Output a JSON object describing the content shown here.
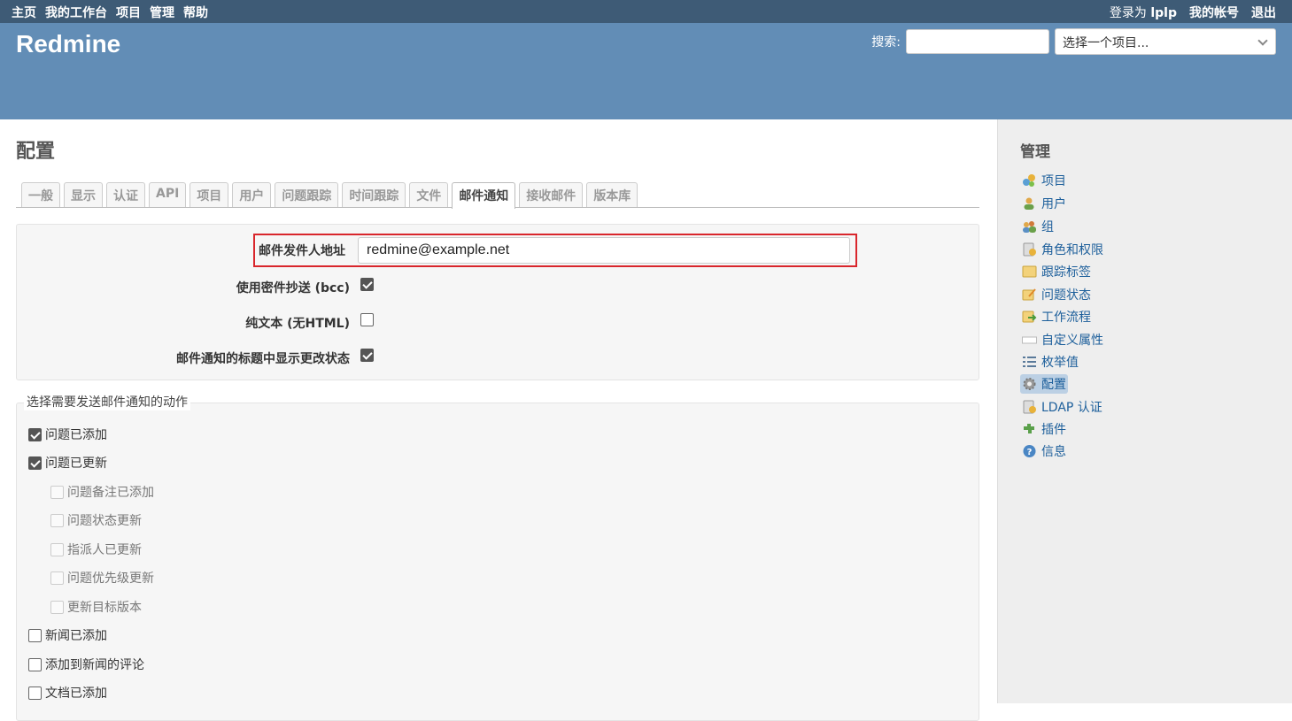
{
  "top_menu": {
    "left_items": [
      "主页",
      "我的工作台",
      "项目",
      "管理",
      "帮助"
    ],
    "logged_as_prefix": "登录为",
    "logged_as_user": "lplp",
    "my_account": "我的帐号",
    "logout": "退出"
  },
  "header": {
    "title": "Redmine",
    "search_label": "搜索:",
    "search_value": "",
    "project_jump_placeholder": "选择一个项目..."
  },
  "page": {
    "title": "配置",
    "tabs": [
      {
        "label": "一般",
        "selected": false
      },
      {
        "label": "显示",
        "selected": false
      },
      {
        "label": "认证",
        "selected": false
      },
      {
        "label": "API",
        "selected": false
      },
      {
        "label": "项目",
        "selected": false
      },
      {
        "label": "用户",
        "selected": false
      },
      {
        "label": "问题跟踪",
        "selected": false
      },
      {
        "label": "时间跟踪",
        "selected": false
      },
      {
        "label": "文件",
        "selected": false
      },
      {
        "label": "邮件通知",
        "selected": true
      },
      {
        "label": "接收邮件",
        "selected": false
      },
      {
        "label": "版本库",
        "selected": false
      }
    ]
  },
  "settings": {
    "from_label": "邮件发件人地址",
    "from_value": "redmine@example.net",
    "bcc_label": "使用密件抄送 (bcc)",
    "bcc_checked": true,
    "plain_text_label": "纯文本 (无HTML)",
    "plain_text_checked": false,
    "status_in_subject_label": "邮件通知的标题中显示更改状态",
    "status_in_subject_checked": true
  },
  "actions": {
    "legend": "选择需要发送邮件通知的动作",
    "items": [
      {
        "label": "问题已添加",
        "checked": true,
        "sub": false
      },
      {
        "label": "问题已更新",
        "checked": true,
        "sub": false
      },
      {
        "label": "问题备注已添加",
        "checked": false,
        "sub": true
      },
      {
        "label": "问题状态更新",
        "checked": false,
        "sub": true
      },
      {
        "label": "指派人已更新",
        "checked": false,
        "sub": true
      },
      {
        "label": "问题优先级更新",
        "checked": false,
        "sub": true
      },
      {
        "label": "更新目标版本",
        "checked": false,
        "sub": true
      },
      {
        "label": "新闻已添加",
        "checked": false,
        "sub": false
      },
      {
        "label": "添加到新闻的评论",
        "checked": false,
        "sub": false
      },
      {
        "label": "文档已添加",
        "checked": false,
        "sub": false
      }
    ]
  },
  "sidebar": {
    "title": "管理",
    "items": [
      {
        "label": "项目",
        "icon": "projects-icon",
        "selected": false
      },
      {
        "label": "用户",
        "icon": "user-icon",
        "selected": false
      },
      {
        "label": "组",
        "icon": "group-icon",
        "selected": false
      },
      {
        "label": "角色和权限",
        "icon": "roles-icon",
        "selected": false
      },
      {
        "label": "跟踪标签",
        "icon": "tracker-icon",
        "selected": false
      },
      {
        "label": "问题状态",
        "icon": "issue-status-icon",
        "selected": false
      },
      {
        "label": "工作流程",
        "icon": "workflow-icon",
        "selected": false
      },
      {
        "label": "自定义属性",
        "icon": "custom-field-icon",
        "selected": false
      },
      {
        "label": "枚举值",
        "icon": "list-icon",
        "selected": false
      },
      {
        "label": "配置",
        "icon": "gear-icon",
        "selected": true
      },
      {
        "label": "LDAP 认证",
        "icon": "ldap-icon",
        "selected": false
      },
      {
        "label": "插件",
        "icon": "plugin-icon",
        "selected": false
      },
      {
        "label": "信息",
        "icon": "help-icon",
        "selected": false
      }
    ]
  }
}
